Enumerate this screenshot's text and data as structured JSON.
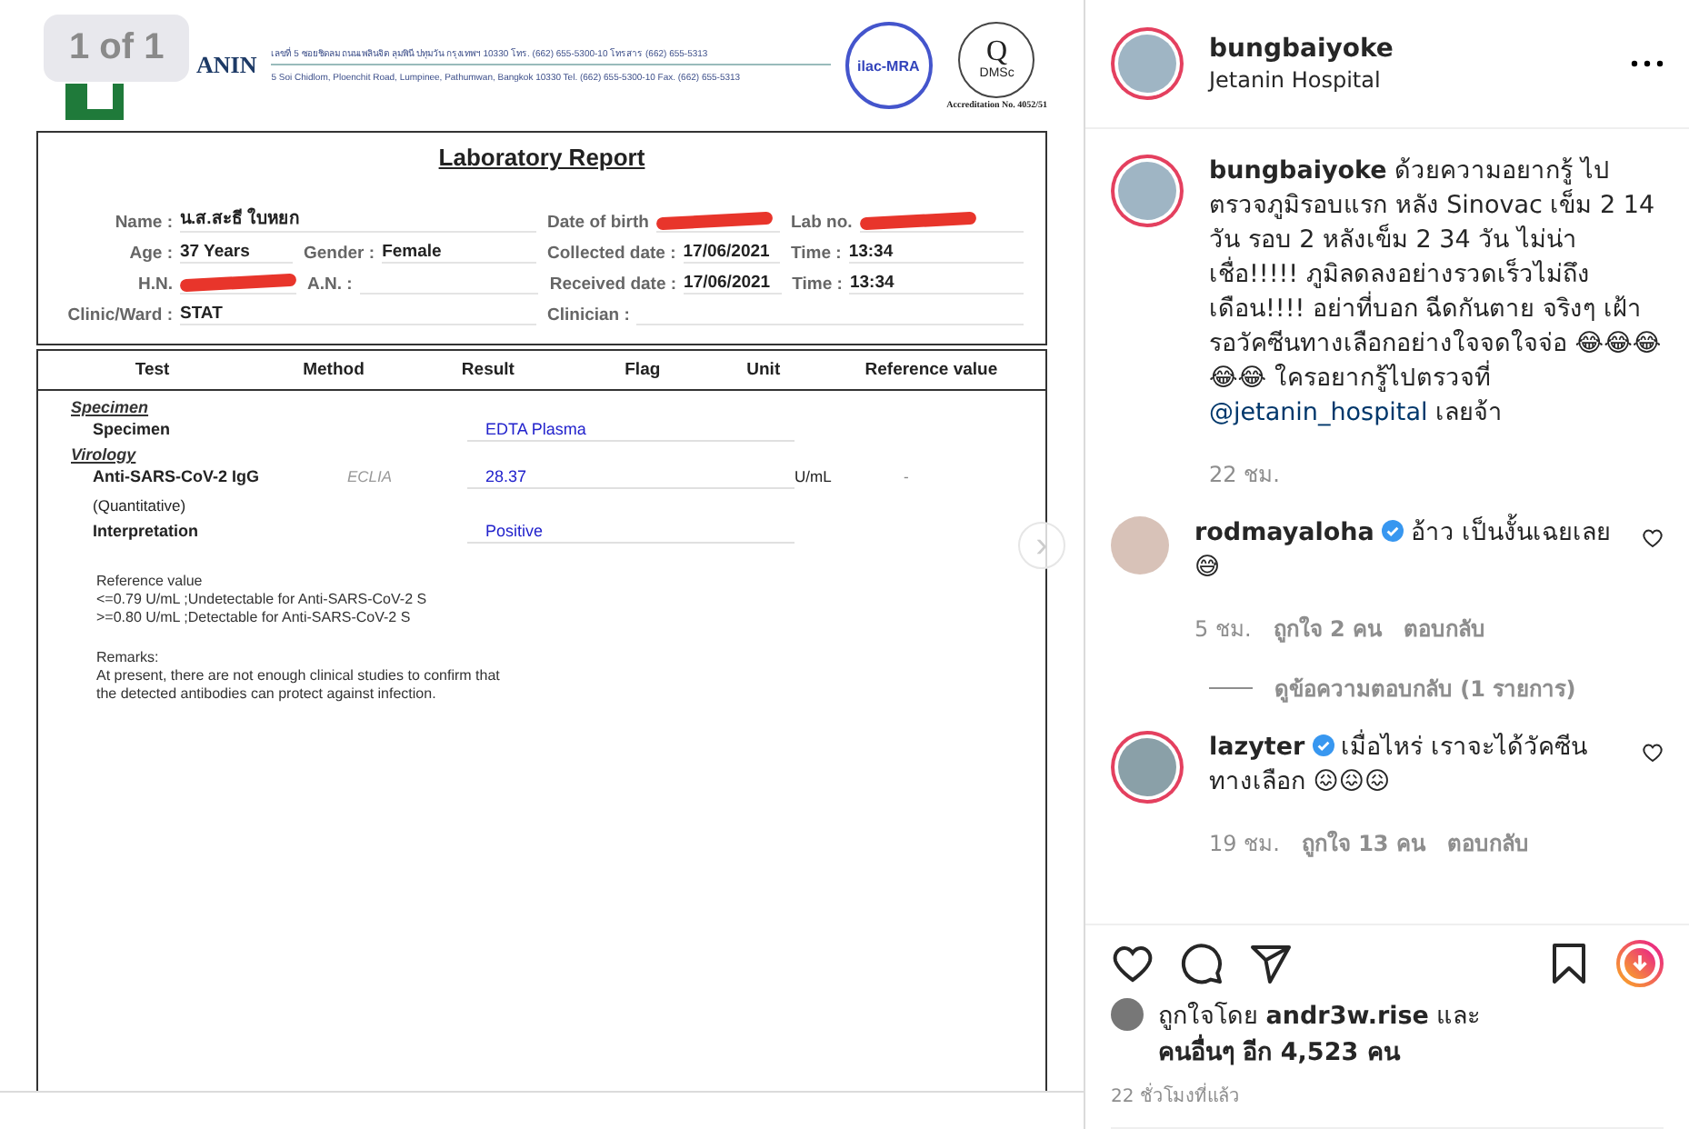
{
  "photo": {
    "counter": "1 of 1",
    "next_label": "›",
    "letterhead": {
      "brand": "ANIN",
      "address_th": "เลขที่ 5 ซอยชิดลม ถนนเพลินจิต ลุมพินี ปทุมวัน กรุงเทพฯ 10330 โทร. (662) 655-5300-10 โทรสาร (662) 655-5313",
      "address_en": "5 Soi Chidlom, Ploenchit Road, Lumpinee, Pathumwan, Bangkok 10330 Tel. (662) 655-5300-10 Fax. (662) 655-5313",
      "logo_1": "ilac-MRA",
      "logo_2_letter": "Q",
      "logo_2_name": "DMSc",
      "accreditation": "Accreditation No. 4052/51"
    },
    "title": "Laboratory Report",
    "field_rows": [
      [
        {
          "label": "Name :",
          "value": "น.ส.สะธี ใบหยก",
          "redacted": false
        },
        {
          "label": "Date of birth",
          "redacted": true
        },
        {
          "label": "Lab no.",
          "redacted": true
        }
      ],
      [
        {
          "label": "Age :",
          "value": "37 Years",
          "redacted": false
        },
        {
          "label": "Gender :",
          "value": "Female",
          "redacted": false
        },
        {
          "label": "Collected date :",
          "value": "17/06/2021",
          "redacted": false
        },
        {
          "label": "Time :",
          "value": "13:34",
          "redacted": false
        }
      ],
      [
        {
          "label": "H.N.",
          "redacted": true
        },
        {
          "label": "A.N. :",
          "redacted": false
        },
        {
          "label": "Received date :",
          "value": "17/06/2021",
          "redacted": false
        },
        {
          "label": "Time :",
          "value": "13:34",
          "redacted": false
        }
      ],
      [
        {
          "label": "Clinic/Ward :",
          "value": "STAT",
          "redacted": false
        },
        {
          "label": "Clinician :",
          "redacted": false
        }
      ]
    ],
    "columns": [
      "Test",
      "Method",
      "Result",
      "Flag",
      "Unit",
      "Reference value"
    ],
    "sections": [
      {
        "name": "Specimen",
        "rows": [
          {
            "test": "Specimen",
            "note": "",
            "method": "",
            "result": "EDTA Plasma",
            "unit": "",
            "reference": ""
          }
        ]
      },
      {
        "name": "Virology",
        "rows": [
          {
            "test": "Anti-SARS-CoV-2 IgG",
            "note": "(Quantitative)",
            "method": "ECLIA",
            "result": "28.37",
            "unit": "U/mL",
            "reference": "-"
          },
          {
            "test": "Interpretation",
            "note": "",
            "method": "",
            "result": "Positive",
            "unit": "",
            "reference": ""
          }
        ]
      }
    ],
    "reference_lines": [
      "Reference value",
      "<=0.79 U/mL ;Undetectable for Anti-SARS-CoV-2 S",
      ">=0.80 U/mL ;Detectable for Anti-SARS-CoV-2 S"
    ],
    "remarks_lines": [
      "Remarks:",
      "At present, there are not enough clinical studies to confirm that",
      "the detected antibodies can protect against infection."
    ]
  },
  "header": {
    "username": "bungbaiyoke",
    "location": "Jetanin Hospital",
    "story_ring": true
  },
  "caption": {
    "username": "bungbaiyoke",
    "text": "ด้วยความอยากรู้ ไปตรวจภูมิรอบแรก หลัง Sinovac เข็ม 2 14 วัน รอบ 2 หลังเข็ม 2 34 วัน ไม่น่าเชื่อ!!!!! ภูมิลดลงอย่างรวดเร็วไม่ถึง เดือน!!!! อย่าที่บอก ฉีดกันตาย จริงๆ เฝ้ารอวัคซีนทางเลือกอย่างใจจดใจจ่อ 😂😂😂😂😂 ใครอยากรู้ไปตรวจที่",
    "mention": "@jetanin_hospital",
    "text_after": "เลยจ้า",
    "time": "22 ชม.",
    "story_ring": true
  },
  "comments": [
    {
      "username": "rodmayaloha",
      "verified": true,
      "story_ring": false,
      "text": "อ้าว เป็นงั้นเฉยเลย 😅",
      "time": "5 ชม.",
      "likes": "ถูกใจ 2 คน",
      "reply": "ตอบกลับ",
      "view_replies": "ดูข้อความตอบกลับ (1 รายการ)",
      "liked": false
    },
    {
      "username": "lazyter",
      "verified": true,
      "story_ring": true,
      "text": "เมื่อไหร่ เราจะได้วัคซีนทางเลือก 😖😖😖",
      "time": "19 ชม.",
      "likes": "ถูกใจ 13 คน",
      "reply": "ตอบกลับ",
      "liked": false
    }
  ],
  "actions": {
    "liked": false,
    "saved": false
  },
  "likes_text": "ถูกใจโดย **andr3w.rise** และ **คนอื่นๆ อีก 4,523 คน**",
  "posted": "22 ชั่วโมงที่แล้ว"
}
